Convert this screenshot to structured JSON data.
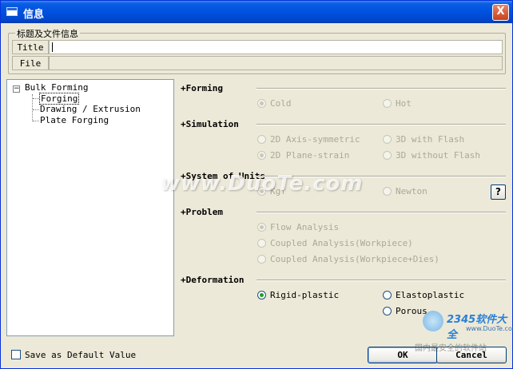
{
  "window": {
    "title": "信息",
    "close_label": "X"
  },
  "header_group": {
    "legend": "标题及文件信息",
    "title_label": "Title",
    "title_value": "",
    "file_label": "File",
    "file_value": ""
  },
  "tree": {
    "root": {
      "expander": "−",
      "label": "Bulk Forming"
    },
    "children": [
      "Forging",
      "Drawing / Extrusion",
      "Plate Forging"
    ],
    "selected": "Forging"
  },
  "sections": {
    "forming": {
      "title": "+Forming",
      "options": [
        "Cold",
        "Hot"
      ],
      "selected": "Cold",
      "enabled": false
    },
    "simulation": {
      "title": "+Simulation",
      "options": [
        "2D Axis-symmetric",
        "3D with Flash",
        "2D Plane-strain",
        "3D without Flash"
      ],
      "selected": "2D Plane-strain",
      "enabled": false
    },
    "units": {
      "title": "+System of Units",
      "options": [
        "Kgf",
        "Newton"
      ],
      "selected": "Kgf",
      "enabled": false,
      "help_label": "?"
    },
    "problem": {
      "title": "+Problem",
      "options": [
        "Flow Analysis",
        "Coupled Analysis(Workpiece)",
        "Coupled Analysis(Workpiece+Dies)"
      ],
      "selected": "Flow Analysis",
      "enabled": false
    },
    "deformation": {
      "title": "+Deformation",
      "options": [
        "Rigid-plastic",
        "Elastoplastic",
        "Porous"
      ],
      "selected": "Rigid-plastic",
      "enabled": true
    }
  },
  "footer": {
    "save_default_label": "Save as Default Value",
    "save_default_checked": false,
    "ok_label": "OK",
    "cancel_label": "Cancel"
  },
  "watermarks": {
    "main": "www.DuoTe.com",
    "logo": "2345软件大全",
    "url": "www.DuoTe.com",
    "sub": "国内最安全的软件站"
  },
  "colors": {
    "titlebar": "#0054e3",
    "dialog_bg": "#ece9d8",
    "radio_on": "#21a121"
  }
}
